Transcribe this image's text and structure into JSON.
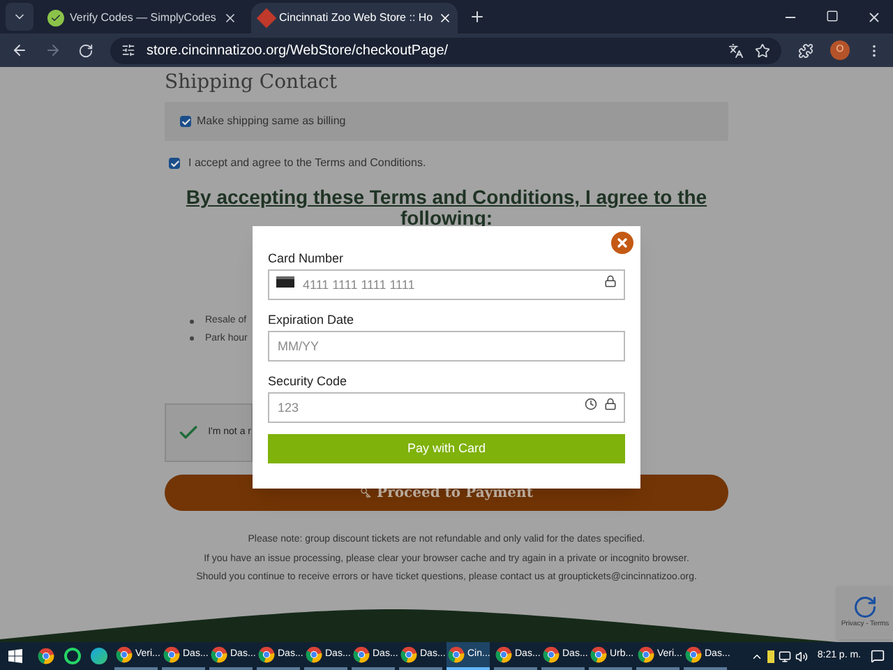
{
  "browser": {
    "tabs": [
      {
        "title": "Verify Codes — SimplyCodes",
        "selected": false
      },
      {
        "title": "Cincinnati Zoo Web Store :: Ho",
        "selected": true
      }
    ],
    "url": "store.cincinnatizoo.org/WebStore/checkoutPage/",
    "profile": "O"
  },
  "page": {
    "section_title": "Shipping Contact",
    "checkboxes": [
      {
        "label": "Make shipping same as billing",
        "checked": true,
        "kind": "boxed"
      },
      {
        "label": "I accept and agree to the Terms and Conditions.",
        "checked": true,
        "kind": "plain"
      }
    ],
    "terms_heading": [
      "By accepting these Terms and Conditions, I agree to the",
      "following:"
    ],
    "bullets": [
      "Resale of",
      "Park hour"
    ],
    "captcha_label": "I'm not a r",
    "captcha_checked": true,
    "proceed_button": "Proceed to Payment",
    "notes": [
      "Please note: group discount tickets are not refundable and only valid for the dates specified.",
      "If you have an issue processing, please clear your browser cache and try again in a private or incognito browser.",
      "Should you continue to receive errors or have ticket questions, please contact us at grouptickets@cincinnatizoo.org."
    ],
    "recaptcha_badge": "Privacy - Terms"
  },
  "payment_dialog": {
    "fields": [
      {
        "label": "Card Number",
        "placeholder": "4111 1111 1111 1111",
        "kind": "card"
      },
      {
        "label": "Expiration Date",
        "placeholder": "MM/YY",
        "kind": "plain"
      },
      {
        "label": "Security Code",
        "placeholder": "123",
        "kind": "cvv"
      }
    ],
    "submit": "Pay with Card"
  },
  "taskbar": {
    "items": [
      {
        "label": "Veri...",
        "selected": false
      },
      {
        "label": "Das...",
        "selected": false
      },
      {
        "label": "Das...",
        "selected": false
      },
      {
        "label": "Das...",
        "selected": false
      },
      {
        "label": "Das...",
        "selected": false
      },
      {
        "label": "Das...",
        "selected": false
      },
      {
        "label": "Das...",
        "selected": false
      },
      {
        "label": "Cin...",
        "selected": true
      },
      {
        "label": "Das...",
        "selected": false
      },
      {
        "label": "Das...",
        "selected": false
      },
      {
        "label": "Urb...",
        "selected": false
      },
      {
        "label": "Veri...",
        "selected": false
      },
      {
        "label": "Das...",
        "selected": false
      }
    ],
    "time": "8:21 p. m."
  }
}
